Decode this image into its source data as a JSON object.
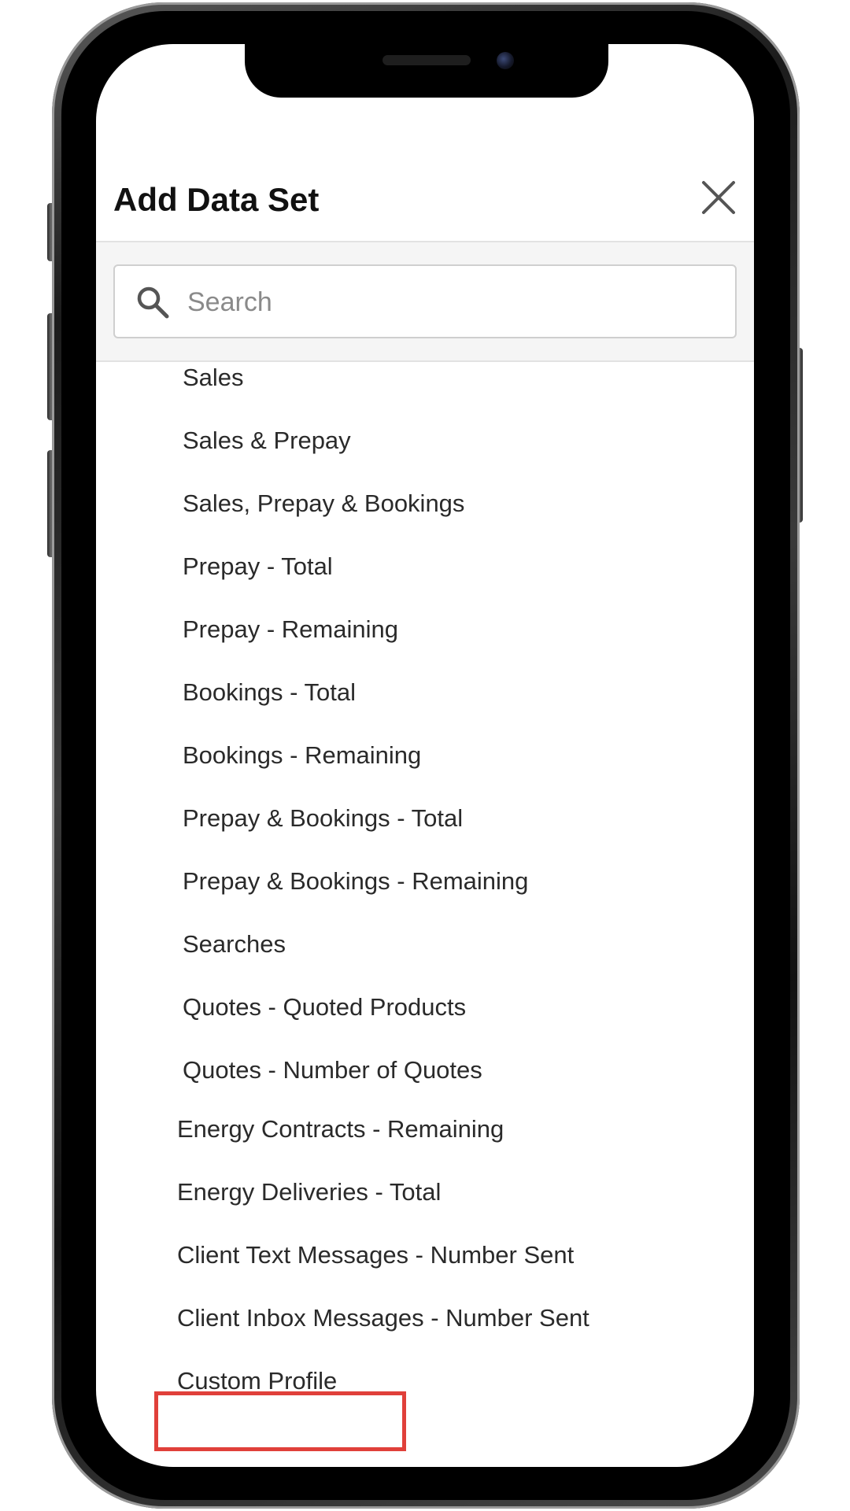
{
  "dialog": {
    "title": "Add Data Set",
    "close_icon": "close-icon"
  },
  "search": {
    "placeholder": "Search",
    "value": "",
    "icon": "search-icon"
  },
  "list": {
    "items": [
      {
        "label": "Sales"
      },
      {
        "label": "Sales & Prepay"
      },
      {
        "label": "Sales, Prepay & Bookings"
      },
      {
        "label": "Prepay - Total"
      },
      {
        "label": "Prepay - Remaining"
      },
      {
        "label": "Bookings - Total"
      },
      {
        "label": "Bookings - Remaining"
      },
      {
        "label": "Prepay & Bookings - Total"
      },
      {
        "label": "Prepay & Bookings - Remaining"
      },
      {
        "label": "Searches"
      },
      {
        "label": "Quotes - Quoted Products"
      },
      {
        "label": "Quotes - Number of Quotes"
      },
      {
        "label": "Energy Contracts - Remaining"
      },
      {
        "label": "Energy Deliveries - Total"
      },
      {
        "label": "Client Text Messages - Number Sent"
      },
      {
        "label": "Client Inbox Messages - Number Sent"
      },
      {
        "label": "Custom Profile"
      }
    ],
    "highlighted_item": "Custom Profile"
  },
  "colors": {
    "highlight": "#e0403a",
    "text": "#2a2a2a",
    "title": "#111111",
    "search_area_bg": "#f5f5f5"
  }
}
